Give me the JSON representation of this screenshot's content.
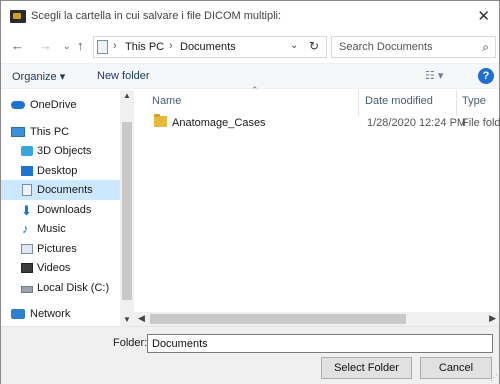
{
  "window": {
    "title": "Scegli la cartella in cui salvare i file DICOM multipli:"
  },
  "address": {
    "crumbs": [
      "This PC",
      "Documents"
    ],
    "search_placeholder": "Search Documents"
  },
  "toolbar": {
    "organize_label": "Organize",
    "new_folder_label": "New folder"
  },
  "sidebar": {
    "items": [
      {
        "label": "OneDrive",
        "icon": "onedrive-icon"
      },
      {
        "label": "This PC",
        "icon": "this-pc-icon"
      },
      {
        "label": "3D Objects",
        "icon": "3d-objects-icon"
      },
      {
        "label": "Desktop",
        "icon": "desktop-icon"
      },
      {
        "label": "Documents",
        "icon": "documents-icon",
        "selected": true
      },
      {
        "label": "Downloads",
        "icon": "downloads-icon"
      },
      {
        "label": "Music",
        "icon": "music-icon"
      },
      {
        "label": "Pictures",
        "icon": "pictures-icon"
      },
      {
        "label": "Videos",
        "icon": "videos-icon"
      },
      {
        "label": "Local Disk (C:)",
        "icon": "local-disk-icon"
      },
      {
        "label": "Network",
        "icon": "network-icon"
      }
    ]
  },
  "files": {
    "columns": [
      "Name",
      "Date modified",
      "Type"
    ],
    "rows": [
      {
        "name": "Anatomage_Cases",
        "date": "1/28/2020 12:24 PM",
        "type": "File folde"
      }
    ]
  },
  "footer": {
    "folder_label": "Folder:",
    "folder_value": "Documents",
    "select_label": "Select Folder",
    "cancel_label": "Cancel"
  },
  "colors": {
    "selection": "#cce8ff",
    "accent": "#1f6fd1"
  }
}
